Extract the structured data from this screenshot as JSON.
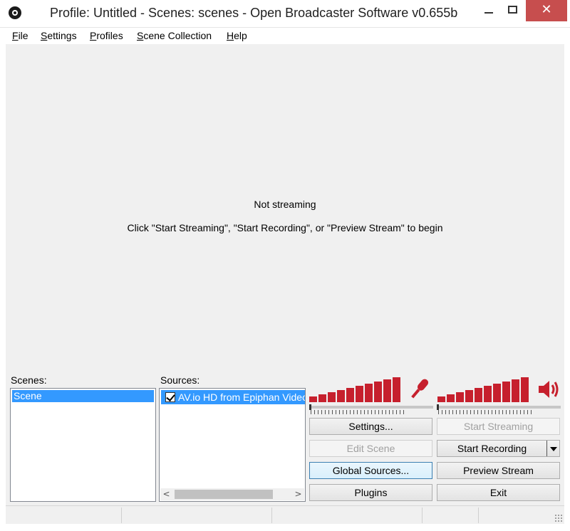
{
  "window": {
    "title": "Profile: Untitled - Scenes: scenes - Open Broadcaster Software v0.655b",
    "close_glyph": "✕"
  },
  "menu": [
    "File",
    "Settings",
    "Profiles",
    "Scene Collection",
    "Help"
  ],
  "preview": {
    "status": "Not streaming",
    "hint": "Click \"Start Streaming\", \"Start Recording\", or \"Preview Stream\" to begin"
  },
  "scenes": {
    "label": "Scenes:",
    "items": [
      "Scene"
    ]
  },
  "sources": {
    "label": "Sources:",
    "items": [
      {
        "name": "AV.io HD from Epiphan Video",
        "checked": true
      }
    ]
  },
  "meters": {
    "mic_icon": "microphone-icon",
    "speaker_icon": "speaker-icon",
    "color": "#c6202d"
  },
  "buttons": {
    "settings": "Settings...",
    "edit_scene": "Edit Scene",
    "global_sources": "Global Sources...",
    "plugins": "Plugins",
    "start_streaming": "Start Streaming",
    "start_recording": "Start Recording",
    "preview_stream": "Preview Stream",
    "exit": "Exit"
  }
}
